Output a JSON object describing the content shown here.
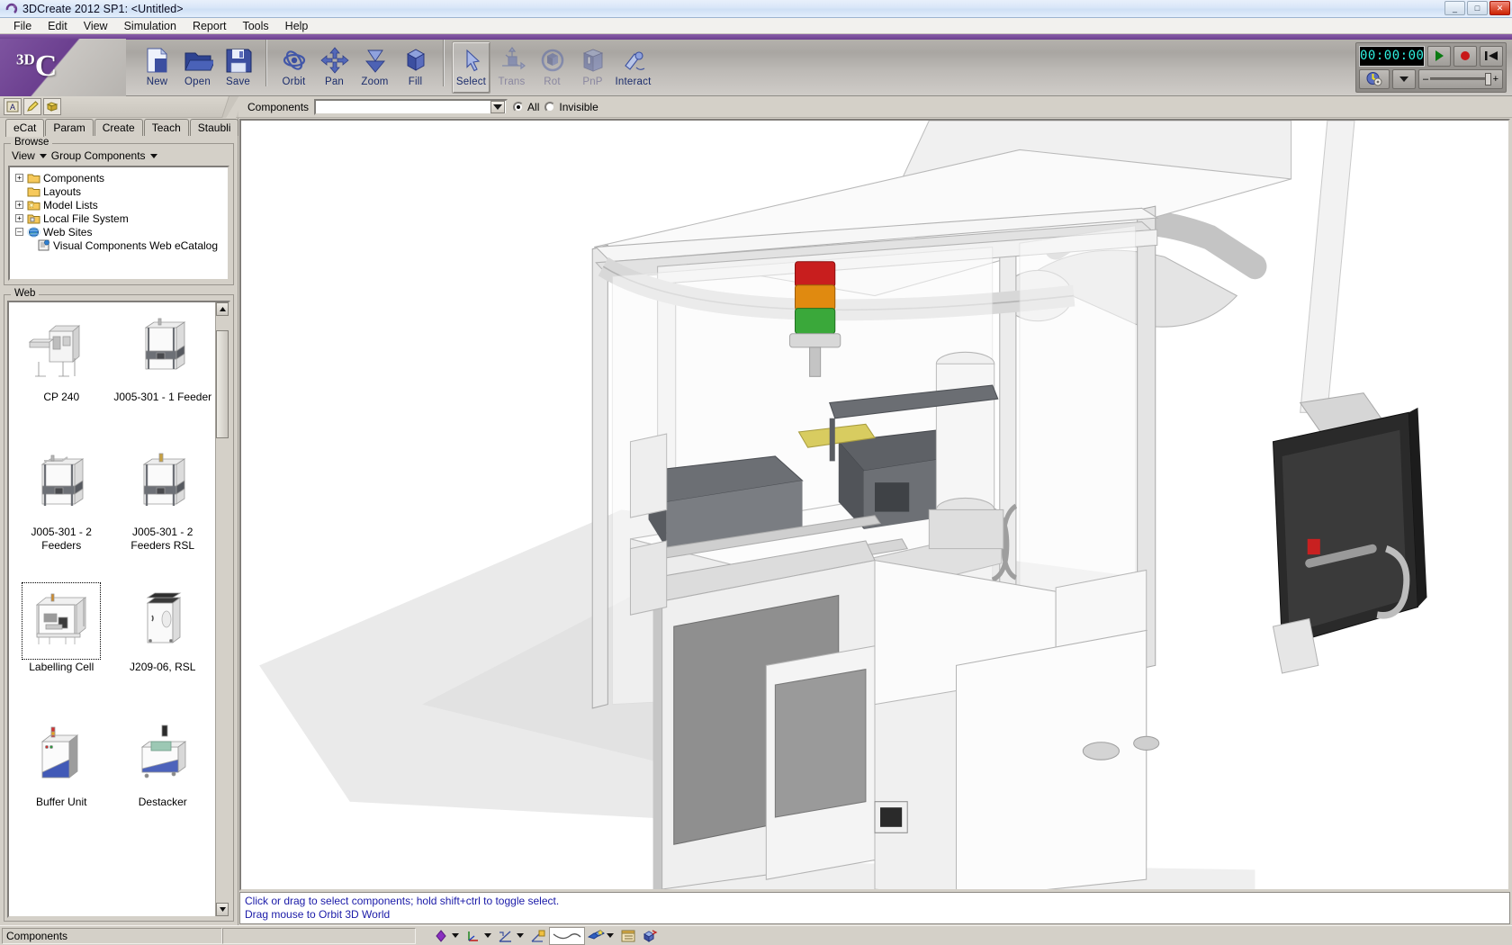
{
  "window": {
    "title": "3DCreate 2012 SP1: <Untitled>",
    "icon": "app-icon",
    "buttons": {
      "minimize": "_",
      "maximize": "□",
      "close": "✕"
    }
  },
  "menu": {
    "items": [
      "File",
      "Edit",
      "View",
      "Simulation",
      "Report",
      "Tools",
      "Help"
    ]
  },
  "toolbar": {
    "groups": [
      {
        "name": "file",
        "buttons": [
          {
            "label": "New",
            "icon": "new-document-icon",
            "state": "enabled"
          },
          {
            "label": "Open",
            "icon": "open-folder-icon",
            "state": "enabled"
          },
          {
            "label": "Save",
            "icon": "floppy-save-icon",
            "state": "enabled"
          }
        ]
      },
      {
        "name": "navigation",
        "buttons": [
          {
            "label": "Orbit",
            "icon": "orbit-icon",
            "state": "enabled"
          },
          {
            "label": "Pan",
            "icon": "pan-arrows-icon",
            "state": "enabled"
          },
          {
            "label": "Zoom",
            "icon": "zoom-arrow-icon",
            "state": "enabled"
          },
          {
            "label": "Fill",
            "icon": "fill-cube-icon",
            "state": "enabled"
          }
        ]
      },
      {
        "name": "manipulation",
        "buttons": [
          {
            "label": "Select",
            "icon": "cursor-arrow-icon",
            "state": "pressed"
          },
          {
            "label": "Trans",
            "icon": "translate-axis-icon",
            "state": "disabled"
          },
          {
            "label": "Rot",
            "icon": "rotate-sphere-icon",
            "state": "disabled"
          },
          {
            "label": "PnP",
            "icon": "pick-and-place-icon",
            "state": "disabled"
          },
          {
            "label": "Interact",
            "icon": "interact-hand-icon",
            "state": "enabled"
          }
        ]
      }
    ]
  },
  "simulation": {
    "time_display": "00:00:00",
    "play_button": "play-icon",
    "record_button": "record-icon",
    "reset_button": "reset-to-start-icon",
    "clock_button": "sim-clock-icon",
    "dropdown_button": "chevron-down-icon",
    "speed_slider": "simulation-speed-slider"
  },
  "secondary_toolbar": {
    "small_buttons": [
      {
        "icon": "annotation-a-icon"
      },
      {
        "icon": "pencil-edit-icon"
      },
      {
        "icon": "geometry-block-icon"
      }
    ],
    "components_label": "Components",
    "components_value": "",
    "components_placeholder": "",
    "filter_all": "All",
    "filter_invisible": "Invisible",
    "filter_selected": "All"
  },
  "left_panel": {
    "tabs": [
      {
        "label": "eCat",
        "active": true
      },
      {
        "label": "Param",
        "active": false
      },
      {
        "label": "Create",
        "active": false
      },
      {
        "label": "Teach",
        "active": false
      },
      {
        "label": "Staubli",
        "active": false
      }
    ],
    "browse": {
      "caption": "Browse",
      "view_label": "View",
      "group_label": "Group Components",
      "tree": [
        {
          "label": "Components",
          "level": 1,
          "expander": "+",
          "icon": "folder-icon"
        },
        {
          "label": "Layouts",
          "level": 1,
          "expander": "",
          "icon": "folder-icon"
        },
        {
          "label": "Model Lists",
          "level": 1,
          "expander": "+",
          "icon": "folder-star-icon"
        },
        {
          "label": "Local File System",
          "level": 1,
          "expander": "+",
          "icon": "folder-lock-icon"
        },
        {
          "label": "Web Sites",
          "level": 1,
          "expander": "-",
          "icon": "globe-icon"
        },
        {
          "label": "Visual Components Web eCatalog",
          "level": 2,
          "expander": "",
          "icon": "web-page-icon"
        }
      ]
    },
    "web": {
      "caption": "Web",
      "items": [
        {
          "label": "CP 240",
          "thumb": "cp240-thumb",
          "selected": false
        },
        {
          "label": "J005-301 - 1 Feeder",
          "thumb": "feeder1-thumb",
          "selected": false
        },
        {
          "label": "J005-301 - 2 Feeders",
          "thumb": "feeder2-thumb",
          "selected": false
        },
        {
          "label": "J005-301 - 2 Feeders RSL",
          "thumb": "feeder2rsl-thumb",
          "selected": false
        },
        {
          "label": "Labelling Cell",
          "thumb": "labelling-cell-thumb",
          "selected": true
        },
        {
          "label": "J209-06, RSL",
          "thumb": "j20906-thumb",
          "selected": false
        },
        {
          "label": "Buffer Unit",
          "thumb": "buffer-unit-thumb",
          "selected": false
        },
        {
          "label": "Destacker",
          "thumb": "destacker-thumb",
          "selected": false
        }
      ]
    }
  },
  "viewport": {
    "scene_name": "labelling-cell-3d-scene",
    "hint_line1": "Click or drag to select components; hold shift+ctrl to toggle select.",
    "hint_line2": "Drag mouse to Orbit 3D World"
  },
  "statusbar": {
    "cell1": "Components",
    "cell2": "",
    "tools": [
      {
        "icon": "snap-point-icon",
        "caret": true
      },
      {
        "icon": "coordinate-axis-icon",
        "caret": true
      },
      {
        "icon": "measure-angle-icon",
        "caret": true
      },
      {
        "icon": "measure-lock-icon",
        "caret": false
      },
      {
        "icon": "curve-tool-icon",
        "caret": false
      },
      {
        "icon": "select-filter-icon",
        "caret": true
      },
      {
        "icon": "properties-panel-icon",
        "caret": false
      },
      {
        "icon": "attach-component-icon",
        "caret": false
      }
    ]
  },
  "colors": {
    "accent_purple": "#6b3f8f",
    "chrome_gray": "#d4d0c8",
    "lcd_text": "#2ff0e0",
    "hint_text": "#1a1aa8",
    "toolbar_label": "#1b2c6b"
  }
}
